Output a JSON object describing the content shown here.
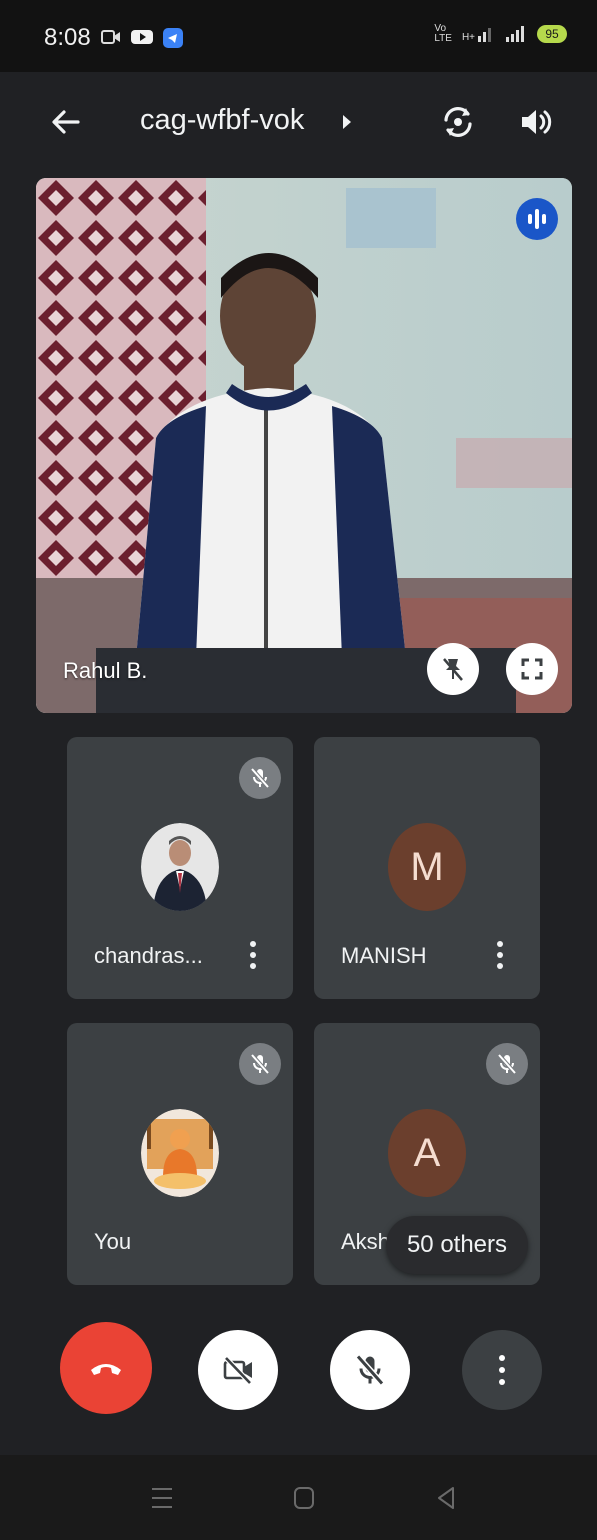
{
  "status_bar": {
    "time": "8:08",
    "network_label_1": "Vo",
    "network_label_2": "LTE",
    "network_label_3": "H+",
    "battery": "95"
  },
  "header": {
    "title": "cag-wfbf-vok"
  },
  "main_video": {
    "participant_name": "Rahul B."
  },
  "tiles": [
    {
      "name": "chandras...",
      "avatar_type": "photo",
      "muted": true
    },
    {
      "name": "MANISH",
      "avatar_letter": "M",
      "avatar_color": "#6b3f2d",
      "muted": false
    },
    {
      "name": "You",
      "avatar_type": "photo",
      "muted": true
    },
    {
      "name": "Aksh",
      "avatar_letter": "A",
      "avatar_color": "#6b3f2d",
      "muted": true
    }
  ],
  "others_chip": "50 others",
  "colors": {
    "end_call": "#ea4335",
    "speaking_indicator": "#1a56c8",
    "tile_background": "#3c4043"
  },
  "icons": {
    "back": "arrow-left-icon",
    "switch_camera": "switch-camera-icon",
    "speaker": "speaker-icon",
    "unpin": "unpin-icon",
    "fullscreen": "fullscreen-icon",
    "mic_off": "mic-off-icon",
    "more": "more-vert-icon",
    "end_call": "phone-hangup-icon",
    "camera_off": "videocam-off-icon"
  }
}
